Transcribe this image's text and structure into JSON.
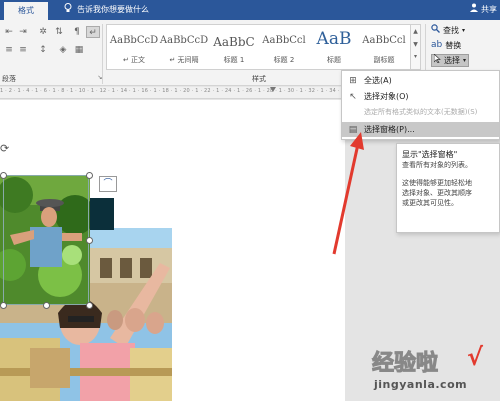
{
  "topbar": {
    "format_tab": "格式",
    "tell_me": "告诉我你想要做什么",
    "share": "共享"
  },
  "ribbon": {
    "paragraph_label": "段落",
    "styles_label": "样式",
    "styles": [
      {
        "sample": "AaBbCcD",
        "name": "↵ 正文"
      },
      {
        "sample": "AaBbCcD",
        "name": "↵ 无间隔"
      },
      {
        "sample": "AaBbC",
        "name": "标题 1"
      },
      {
        "sample": "AaBbCcl",
        "name": "标题 2"
      },
      {
        "sample": "AaB",
        "name": "标题"
      },
      {
        "sample": "AaBbCcl",
        "name": "副标题"
      }
    ],
    "editing": {
      "find": "查找",
      "replace": "替换",
      "select": "选择"
    }
  },
  "ruler": {
    "numbers": "1 · 2 · 1 · 4 · 1 · 6 · 1 · 8 · 1 · 10 · 1 · 12 · 1 · 14 · 1 · 16 · 1 · 18 · 1 · 20 · 1 · 22 · 1 · 24 · 1 · 26 · 1 · 28 · 1 · 30 · 1 · 32 · 1 · 34 · 1 · 36 · 1 · 38 · 1 · 40 · 1 · 42 · 1 · 44 · 1 · 46 · 1 · 48"
  },
  "menu": {
    "items": [
      {
        "label": "全选(A)",
        "disabled": false
      },
      {
        "label": "选择对象(O)",
        "disabled": false
      },
      {
        "label": "选定所有格式类似的文本(无数据)(S)",
        "disabled": true
      },
      {
        "label": "选择窗格(P)...",
        "disabled": false
      }
    ]
  },
  "tooltip": {
    "title": "显示\"选择窗格\"",
    "line1": "查看所有对象的列表。",
    "line2": "这使得能够更加轻松地",
    "line3": "选择对象、更改其顺序",
    "line4": "或更改其可见性。"
  },
  "watermark": {
    "chinese": "经验啦",
    "url": "jingyanla.com"
  },
  "colors": {
    "title_bar": "#2b579a",
    "arrow": "#e23a2e"
  }
}
